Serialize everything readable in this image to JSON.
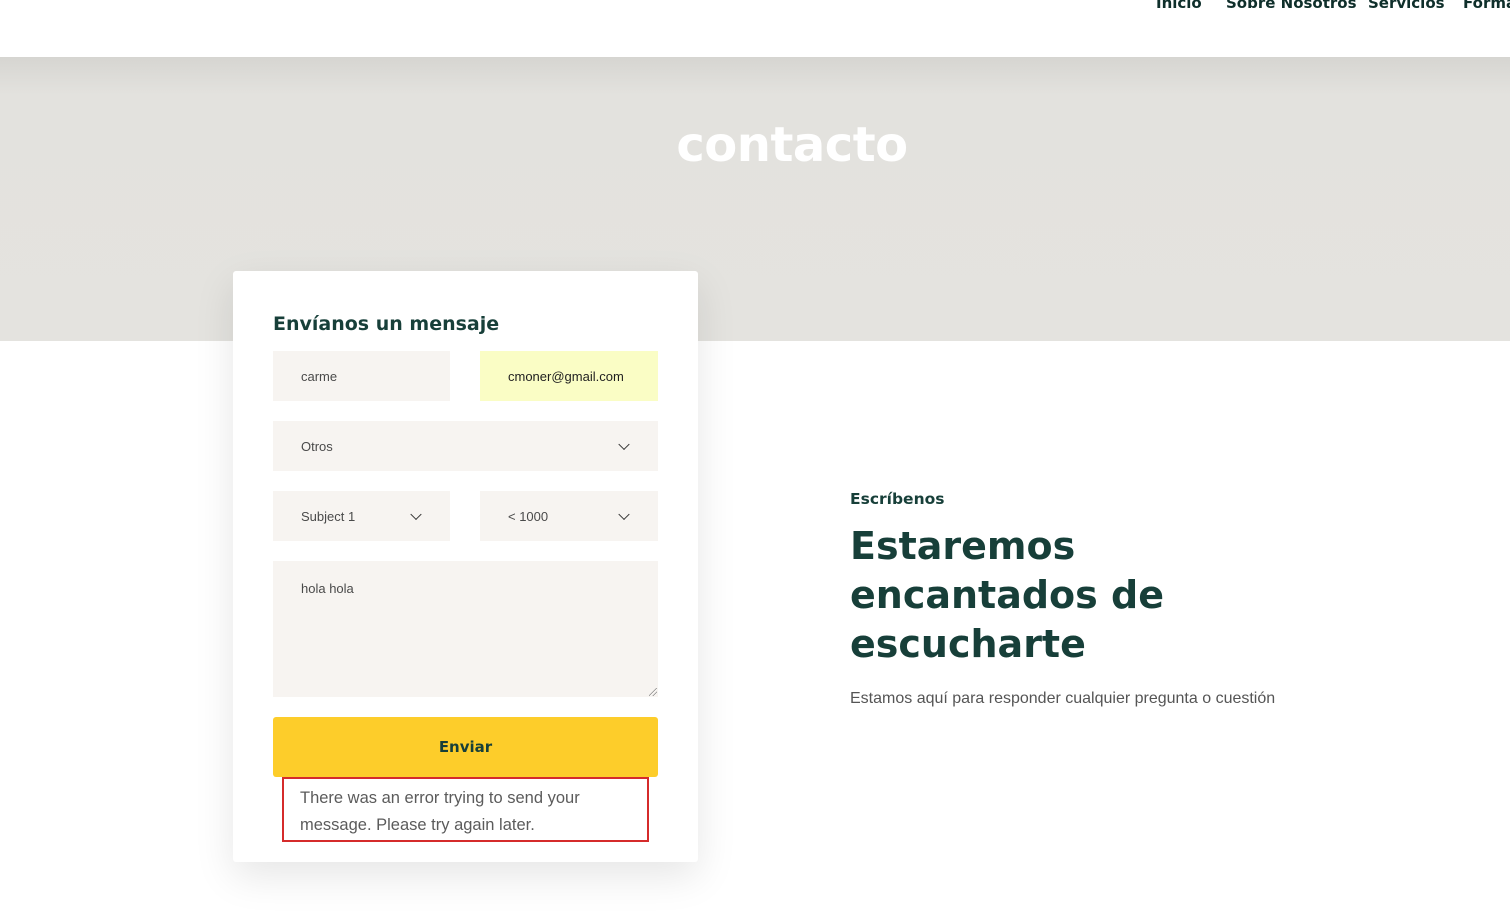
{
  "nav": {
    "items": [
      "Inicio",
      "Sobre Nosotros",
      "Servicios",
      "Forma"
    ]
  },
  "hero": {
    "title": "contacto"
  },
  "form": {
    "title": "Envíanos un mensaje",
    "name_value": "carme",
    "email_value": "cmoner@gmail.com",
    "category_value": "Otros",
    "subject_value": "Subject 1",
    "budget_value": "< 1000",
    "message_value": "hola hola",
    "submit_label": "Enviar",
    "error_message": "There was an error trying to send your message. Please try again later."
  },
  "contact_info": {
    "kicker": "Escríbenos",
    "heading": "Estaremos encantados de escucharte",
    "lead": "Estamos aquí para responder cualquier pregunta o cuestión"
  },
  "colors": {
    "brand_dark": "#173f39",
    "accent_yellow": "#fdcd2a",
    "field_bg": "#f7f4f1",
    "autofill_bg": "#fafdc5",
    "error_red": "#d52b2b",
    "hero_bg": "#e4e3df"
  },
  "icons": {
    "select_arrow": "chevron-down-icon",
    "textarea_resize": "resize-grip-icon"
  }
}
